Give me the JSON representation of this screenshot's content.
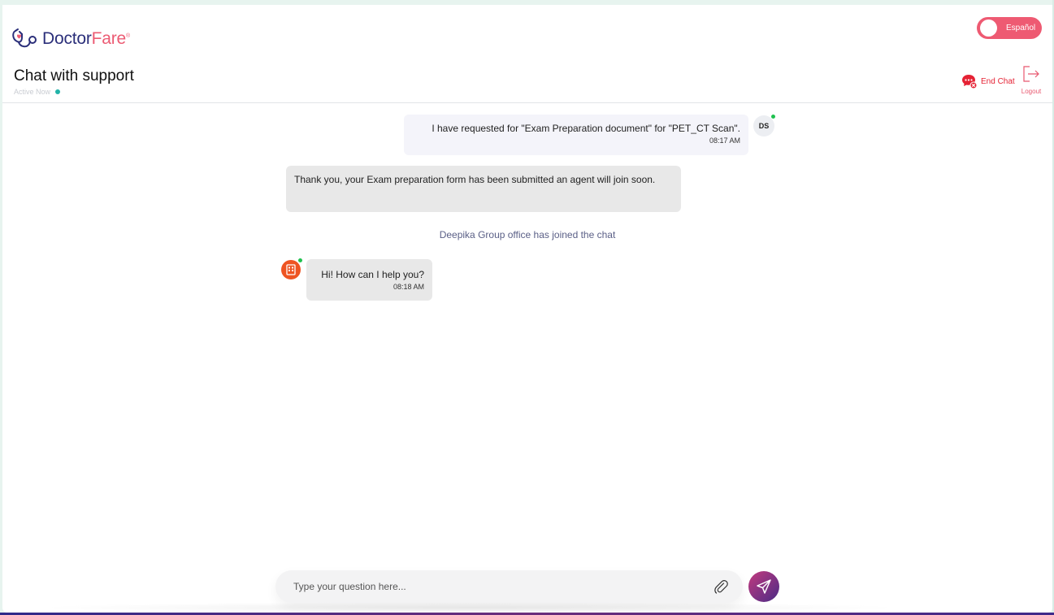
{
  "brand": {
    "name_part1": "Doctor",
    "name_part2": "Fare",
    "reg_mark": "®",
    "colors": {
      "navy": "#2b2f7a",
      "pink": "#ec5b73"
    }
  },
  "header": {
    "language_toggle_label": "Español",
    "title": "Chat with support",
    "status_text": "Active Now",
    "end_chat_label": "End Chat",
    "logout_label": "Logout"
  },
  "messages": {
    "user": {
      "initials": "DS",
      "text": "I have requested for \"Exam Preparation document\" for \"PET_CT Scan\".",
      "time": "08:17 AM"
    },
    "bot": {
      "text": "Thank you, your Exam preparation form has been submitted an agent will join soon."
    },
    "system": {
      "text": "Deepika Group office has joined the chat"
    },
    "agent": {
      "text": "Hi! How can I help you?",
      "time": "08:18 AM"
    }
  },
  "composer": {
    "placeholder": "Type your question here..."
  },
  "icons": {
    "logo": "stethoscope-heart-icon",
    "end_chat": "chat-bubble-x-icon",
    "logout": "logout-arrow-icon",
    "agent_avatar": "building-icon",
    "attach": "paperclip-icon",
    "send": "paper-plane-icon"
  }
}
